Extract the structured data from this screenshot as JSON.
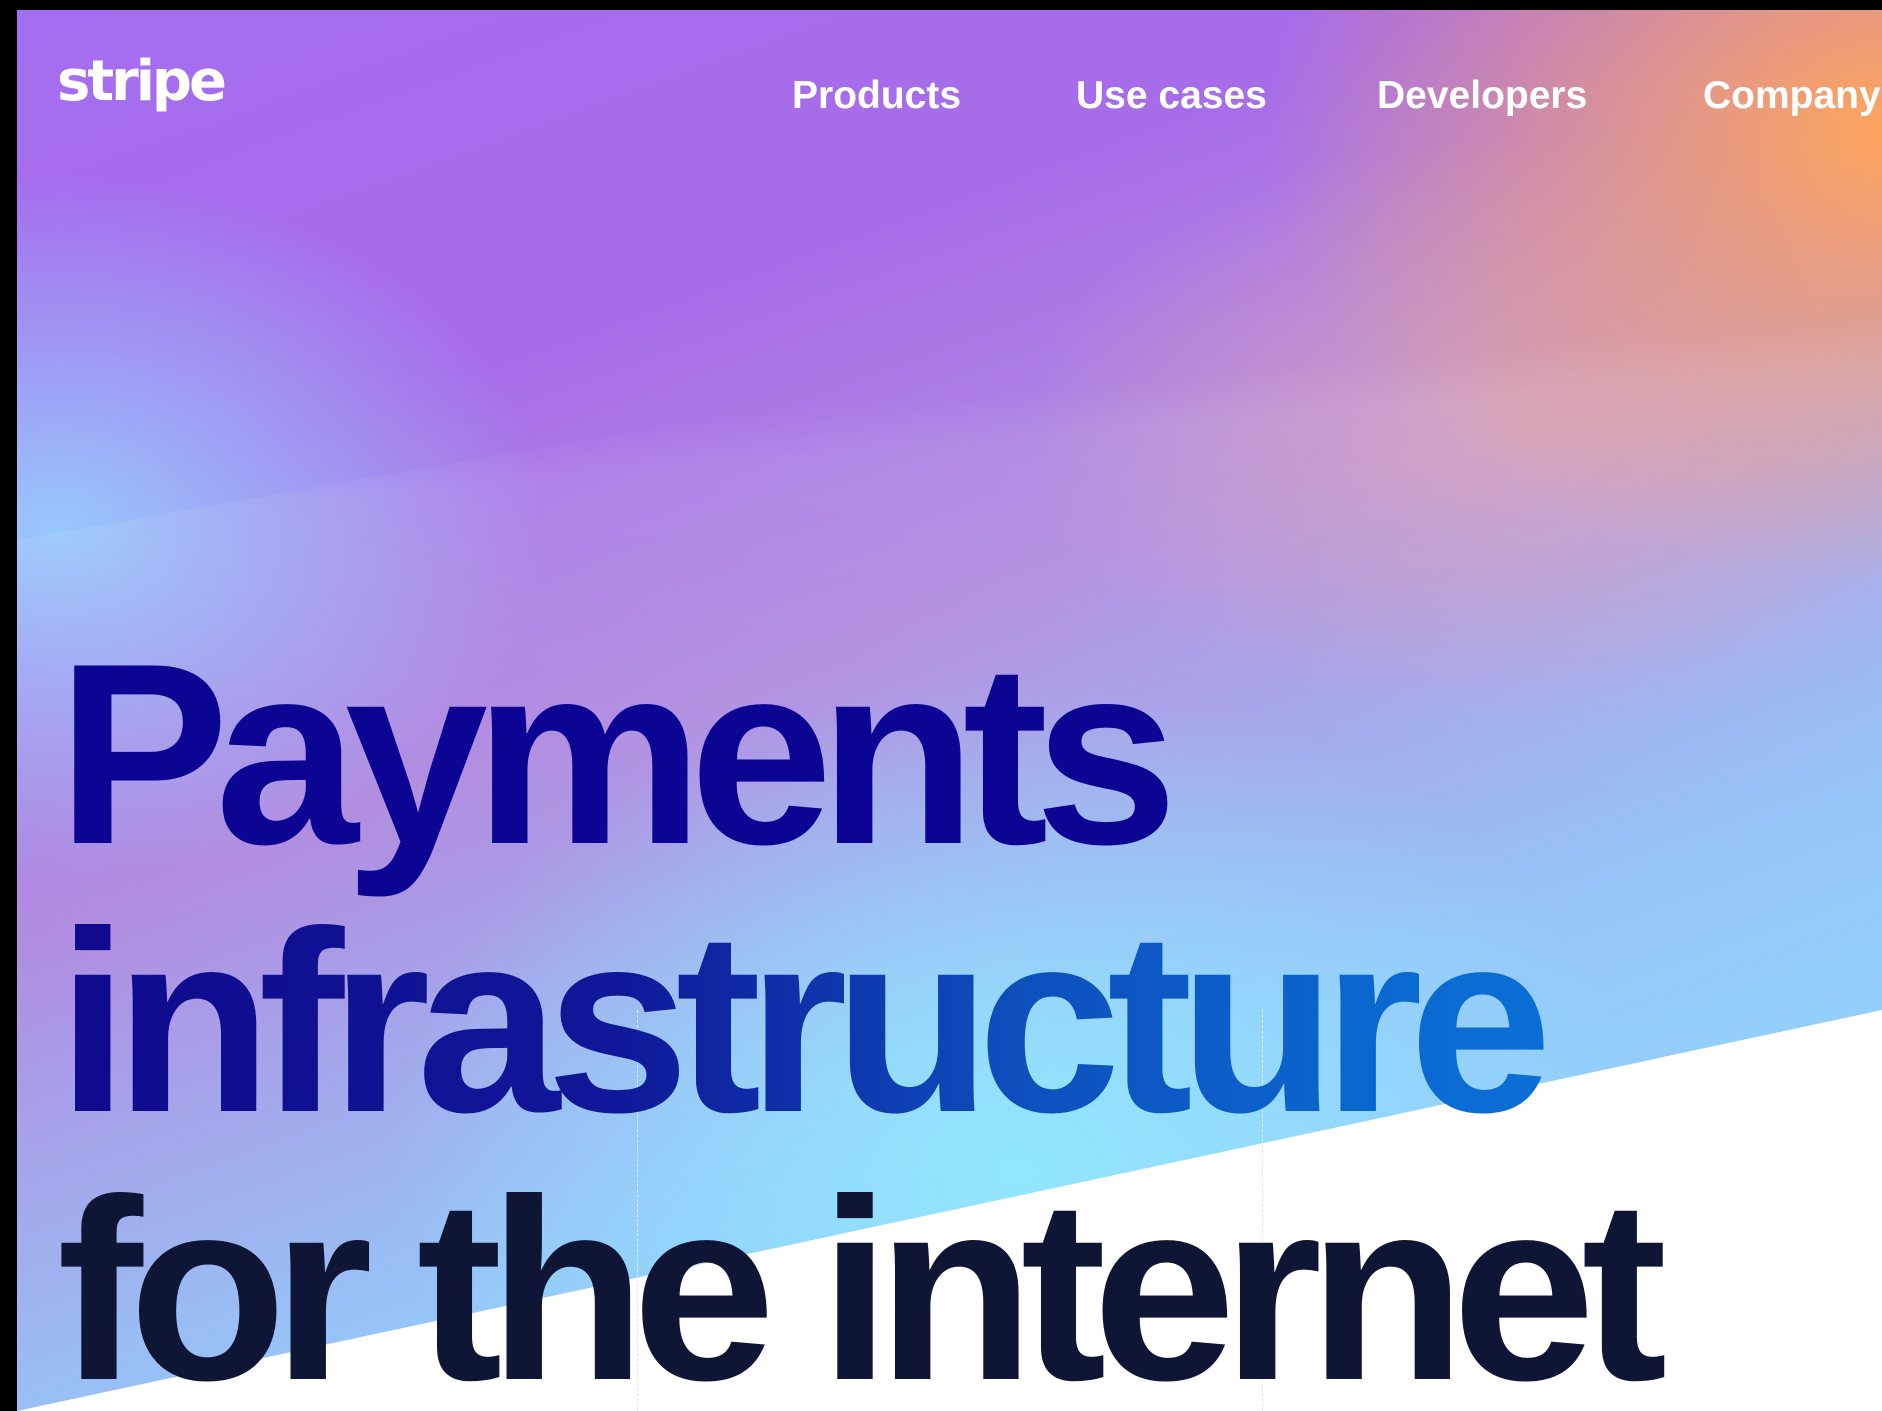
{
  "brand": {
    "logo_text": "stripe"
  },
  "nav": {
    "items": [
      {
        "label": "Products"
      },
      {
        "label": "Use cases"
      },
      {
        "label": "Developers"
      },
      {
        "label": "Company"
      }
    ]
  },
  "hero": {
    "lines": [
      "Payments",
      "infrastructure",
      "for the internet"
    ]
  },
  "colors": {
    "gradient_purple": "#a46ef0",
    "gradient_orange": "#ffa55a",
    "gradient_cyan": "#8fe0ff",
    "hero_navy": "#0c0594",
    "hero_dark": "#0f1535",
    "background_white": "#ffffff"
  }
}
